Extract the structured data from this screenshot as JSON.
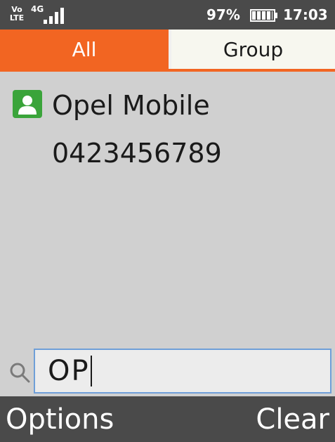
{
  "status_bar": {
    "volte_top": "Vo",
    "volte_bottom": "LTE",
    "network": "4G",
    "signal_level": 4,
    "battery_percent": "97%",
    "battery_level": 0.97,
    "time": "17:03"
  },
  "tabs": [
    {
      "label": "All",
      "selected": true
    },
    {
      "label": "Group",
      "selected": false
    }
  ],
  "contacts": [
    {
      "name": "Opel Mobile",
      "number": "0423456789",
      "icon": "contact-icon"
    }
  ],
  "search": {
    "icon": "search-icon",
    "value": "OP"
  },
  "softkeys": {
    "left": "Options",
    "right": "Clear"
  },
  "colors": {
    "accent": "#f26522",
    "status_bar": "#4a4a4a",
    "list_background": "#d0d0d0",
    "contact_icon": "#3aa43a",
    "search_border": "#6f9fd8"
  }
}
